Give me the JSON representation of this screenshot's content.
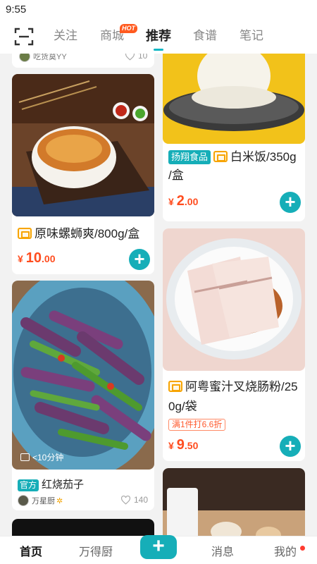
{
  "status_bar": {
    "time": "9:55"
  },
  "top_tabs": [
    {
      "label": "关注"
    },
    {
      "label": "商城",
      "badge": "HOT"
    },
    {
      "label": "推荐"
    },
    {
      "label": "食谱"
    },
    {
      "label": "笔记"
    }
  ],
  "active_tab": "推荐",
  "left_column": {
    "partial_card": {
      "author": "吃货莫YY",
      "likes": "10"
    },
    "product_1": {
      "title": "原味螺蛳爽/800g/盒",
      "price_symbol": "¥",
      "price_int": "10",
      "price_dec": ".00"
    },
    "recipe_1": {
      "time": "<10分钟",
      "tag": "官方",
      "title": "红烧茄子",
      "author": "万星厨",
      "likes": "140"
    }
  },
  "right_column": {
    "product_1": {
      "brand": "扬翔食品",
      "title_line1": "白米饭/350g",
      "title_line2": "/盒",
      "price_symbol": "¥",
      "price_int": "2",
      "price_dec": ".00"
    },
    "product_2": {
      "title_line1": "阿粤蜜汁叉烧肠粉/25",
      "title_line2": "0g/袋",
      "promo": "满1件打6.6折",
      "price_symbol": "¥",
      "price_int": "9",
      "price_dec": ".50"
    }
  },
  "bottom_nav": [
    {
      "label": "首页"
    },
    {
      "label": "万得厨"
    },
    {
      "label": "+"
    },
    {
      "label": "消息"
    },
    {
      "label": "我的"
    }
  ],
  "colors": {
    "accent": "#16aeb8",
    "price": "#ff4d1f",
    "store_icon": "#f7a400"
  }
}
